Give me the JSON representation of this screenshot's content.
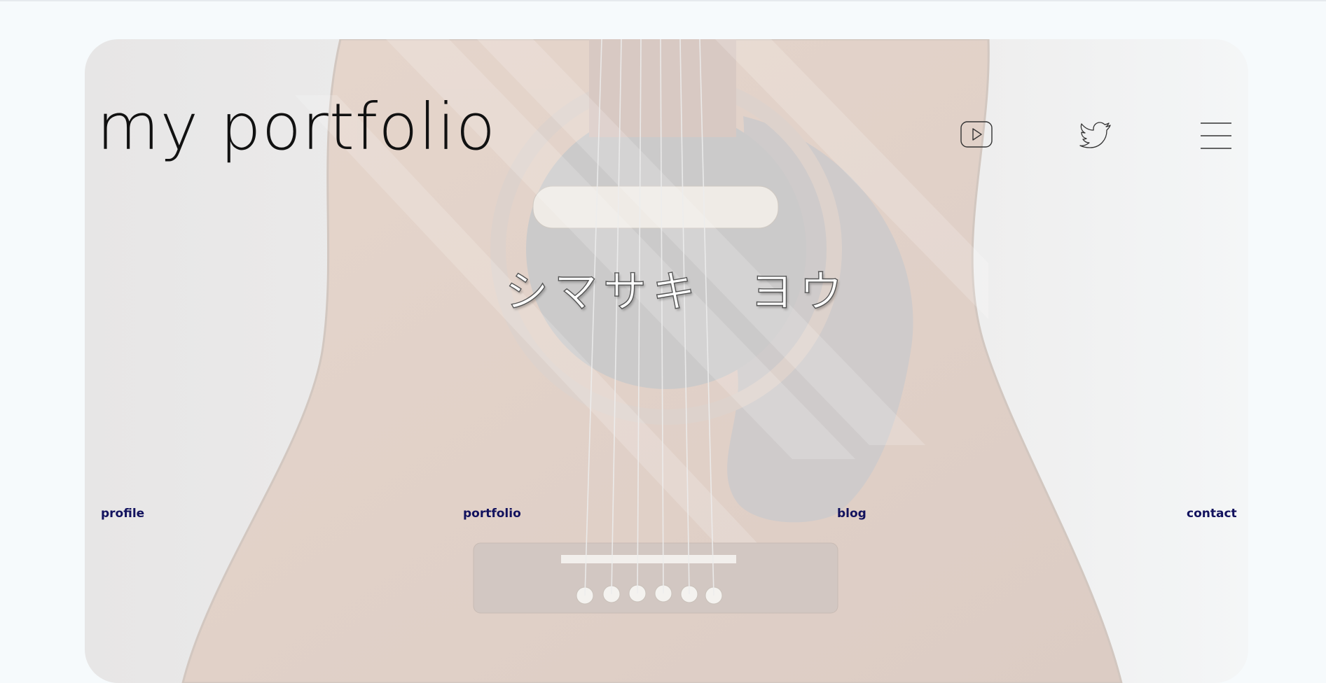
{
  "header": {
    "title": "my portfolio"
  },
  "hero": {
    "name": "シマサキ　ヨウ",
    "background": "acoustic-guitar-photo"
  },
  "social": {
    "youtube_icon": "youtube-icon",
    "twitter_icon": "twitter-icon",
    "menu_icon": "hamburger-menu-icon"
  },
  "nav": {
    "items": [
      {
        "label": "profile"
      },
      {
        "label": "portfolio"
      },
      {
        "label": "blog"
      },
      {
        "label": "contact"
      }
    ]
  },
  "colors": {
    "page_bg": "#f6fafc",
    "nav_text": "#12125e",
    "title_text": "#111111"
  }
}
